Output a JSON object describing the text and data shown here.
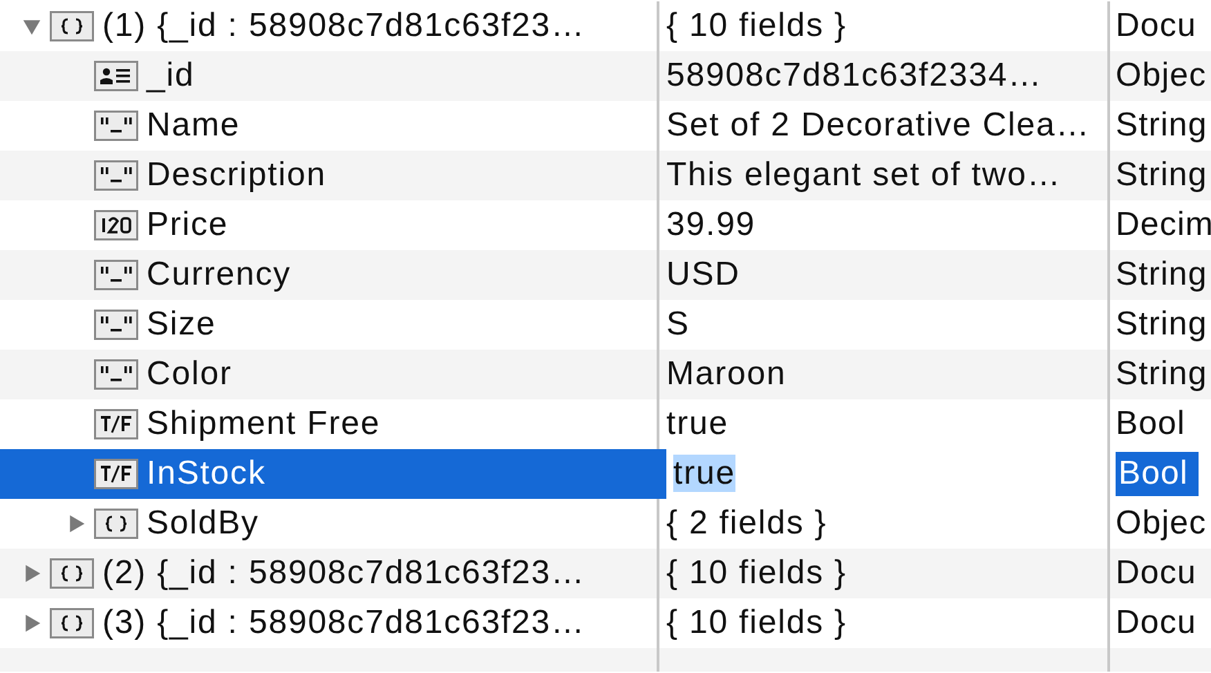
{
  "tree": {
    "rows": [
      {
        "key": "(1) {_id : 58908c7d81c63f23…",
        "value": "{ 10 fields }",
        "type": "Docu",
        "kind": "document",
        "expanded": true,
        "selected": false,
        "children": [
          {
            "key": "_id",
            "value": "58908c7d81c63f2334…",
            "type": "Objec",
            "kind": "objectid",
            "selected": false
          },
          {
            "key": "Name",
            "value": "Set of 2 Decorative Clea…",
            "type": "String",
            "kind": "string",
            "selected": false
          },
          {
            "key": "Description",
            "value": "This elegant set of two…",
            "type": "String",
            "kind": "string",
            "selected": false
          },
          {
            "key": "Price",
            "value": "39.99",
            "type": "Decim",
            "kind": "number",
            "selected": false
          },
          {
            "key": "Currency",
            "value": "USD",
            "type": "String",
            "kind": "string",
            "selected": false
          },
          {
            "key": "Size",
            "value": "S",
            "type": "String",
            "kind": "string",
            "selected": false
          },
          {
            "key": "Color",
            "value": "Maroon",
            "type": "String",
            "kind": "string",
            "selected": false
          },
          {
            "key": "Shipment Free",
            "value": "true",
            "type": "Bool",
            "kind": "boolean",
            "selected": false
          },
          {
            "key": "InStock",
            "value": "true",
            "type": "Bool",
            "kind": "boolean",
            "selected": true
          },
          {
            "key": "SoldBy",
            "value": "{ 2 fields }",
            "type": "Objec",
            "kind": "document",
            "expanded": false,
            "selected": false
          }
        ]
      },
      {
        "key": "(2) {_id : 58908c7d81c63f23…",
        "value": "{ 10 fields }",
        "type": "Docu",
        "kind": "document",
        "expanded": false,
        "selected": false
      },
      {
        "key": "(3) {_id : 58908c7d81c63f23…",
        "value": "{ 10 fields }",
        "type": "Docu",
        "kind": "document",
        "expanded": false,
        "selected": false
      }
    ]
  }
}
